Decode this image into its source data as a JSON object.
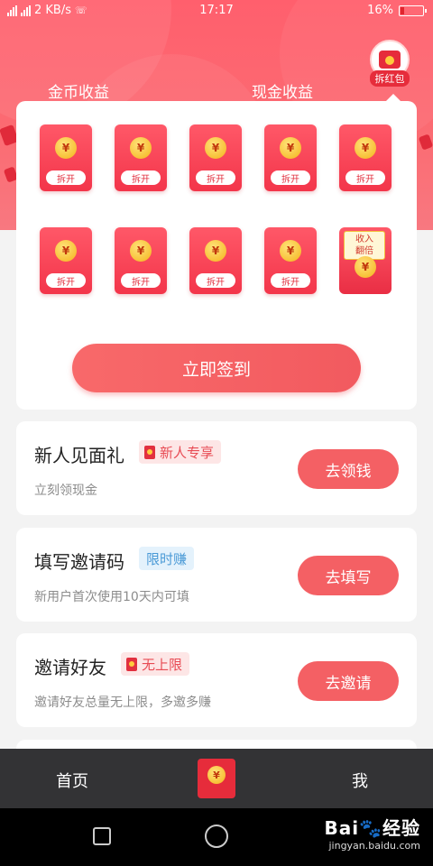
{
  "status_bar": {
    "network_speed": "2 KB/s",
    "time": "17:17",
    "battery_percent": "16%",
    "battery_level": 0.16
  },
  "tabs": {
    "coin_income": "金币收益",
    "cash_income": "现金收益"
  },
  "red_packet_badge": {
    "label": "拆红包"
  },
  "envelopes": {
    "coin_symbol": "¥",
    "open_label": "拆开",
    "special_tag_line1": "收入",
    "special_tag_line2": "翻倍"
  },
  "signin": {
    "button_label": "立即签到"
  },
  "tasks": [
    {
      "title": "新人见面礼",
      "badge": "新人专享",
      "subtitle": "立刻领现金",
      "action": "去领钱"
    },
    {
      "title": "填写邀请码",
      "badge": "限时赚",
      "subtitle": "新用户首次使用10天内可填",
      "action": "去填写"
    },
    {
      "title": "邀请好友",
      "badge": "无上限",
      "subtitle": "邀请好友总量无上限，多邀多赚",
      "action": "去邀请"
    }
  ],
  "tab_bar": {
    "home": "首页",
    "me": "我"
  },
  "watermark": {
    "main": "Bai🐾经验",
    "sub": "jingyan.baidu.com"
  },
  "colors": {
    "header": "#ff5f6d",
    "accent_button": "#f46064",
    "envelope_red": "#f3354a",
    "coin_gold": "#f4b21a",
    "tab_bar_bg": "#333335"
  }
}
